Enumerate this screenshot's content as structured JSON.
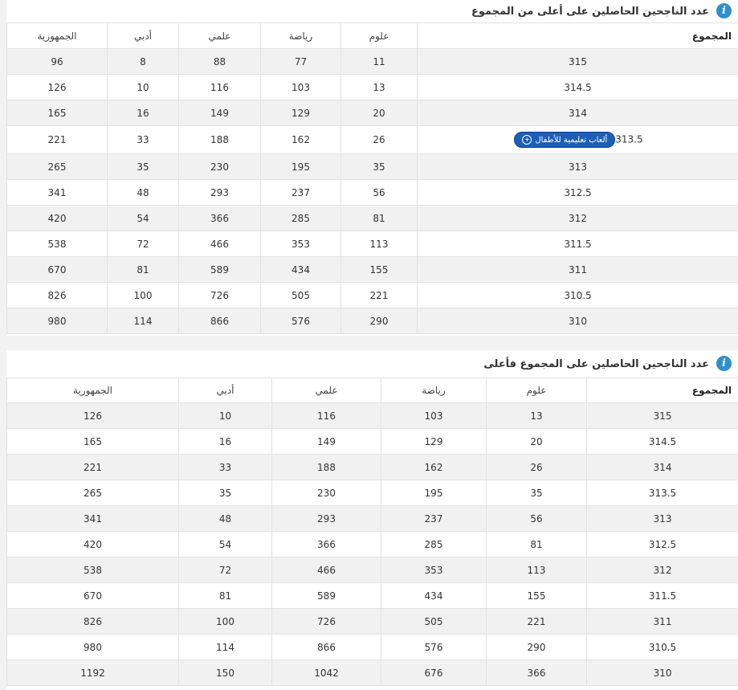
{
  "section1": {
    "title": "عدد الناجحين الحاصلين على أعلى من المجموع",
    "headers": [
      "المجموع",
      "علوم",
      "رياضة",
      "علمي",
      "أدبي",
      "الجمهورية"
    ],
    "rows": [
      [
        "315",
        "11",
        "77",
        "88",
        "8",
        "96"
      ],
      [
        "314.5",
        "13",
        "103",
        "116",
        "10",
        "126"
      ],
      [
        "314",
        "20",
        "129",
        "149",
        "16",
        "165"
      ],
      [
        "313.5",
        "26",
        "162",
        "188",
        "33",
        "221"
      ],
      [
        "313",
        "35",
        "195",
        "230",
        "35",
        "265"
      ],
      [
        "312.5",
        "56",
        "237",
        "293",
        "48",
        "341"
      ],
      [
        "312",
        "81",
        "285",
        "366",
        "54",
        "420"
      ],
      [
        "311.5",
        "113",
        "353",
        "466",
        "72",
        "538"
      ],
      [
        "311",
        "155",
        "434",
        "589",
        "81",
        "670"
      ],
      [
        "310.5",
        "221",
        "505",
        "726",
        "100",
        "826"
      ],
      [
        "310",
        "290",
        "576",
        "866",
        "114",
        "980"
      ]
    ],
    "ad_badge": "ألعاب تعليمية للأطفال"
  },
  "section2": {
    "title": "عدد الناجحين الحاصلين على المجموع فأعلى",
    "headers": [
      "المجموع",
      "علوم",
      "رياضة",
      "علمي",
      "أدبي",
      "الجمهورية"
    ],
    "rows": [
      [
        "315",
        "13",
        "103",
        "116",
        "10",
        "126"
      ],
      [
        "314.5",
        "20",
        "129",
        "149",
        "16",
        "165"
      ],
      [
        "314",
        "26",
        "162",
        "188",
        "33",
        "221"
      ],
      [
        "313.5",
        "35",
        "195",
        "230",
        "35",
        "265"
      ],
      [
        "313",
        "56",
        "237",
        "293",
        "48",
        "341"
      ],
      [
        "312.5",
        "81",
        "285",
        "366",
        "54",
        "420"
      ],
      [
        "312",
        "113",
        "353",
        "466",
        "72",
        "538"
      ],
      [
        "311.5",
        "155",
        "434",
        "589",
        "81",
        "670"
      ],
      [
        "311",
        "221",
        "505",
        "726",
        "100",
        "826"
      ],
      [
        "310.5",
        "290",
        "576",
        "866",
        "114",
        "980"
      ],
      [
        "310",
        "366",
        "676",
        "1042",
        "150",
        "1192"
      ]
    ]
  },
  "icons": {
    "info": "info-icon",
    "badge": "plus-circle-icon"
  },
  "colors": {
    "info_icon": "#2f8fcd",
    "badge": "#1b5fb7",
    "stripe": "#f1f1f1"
  }
}
